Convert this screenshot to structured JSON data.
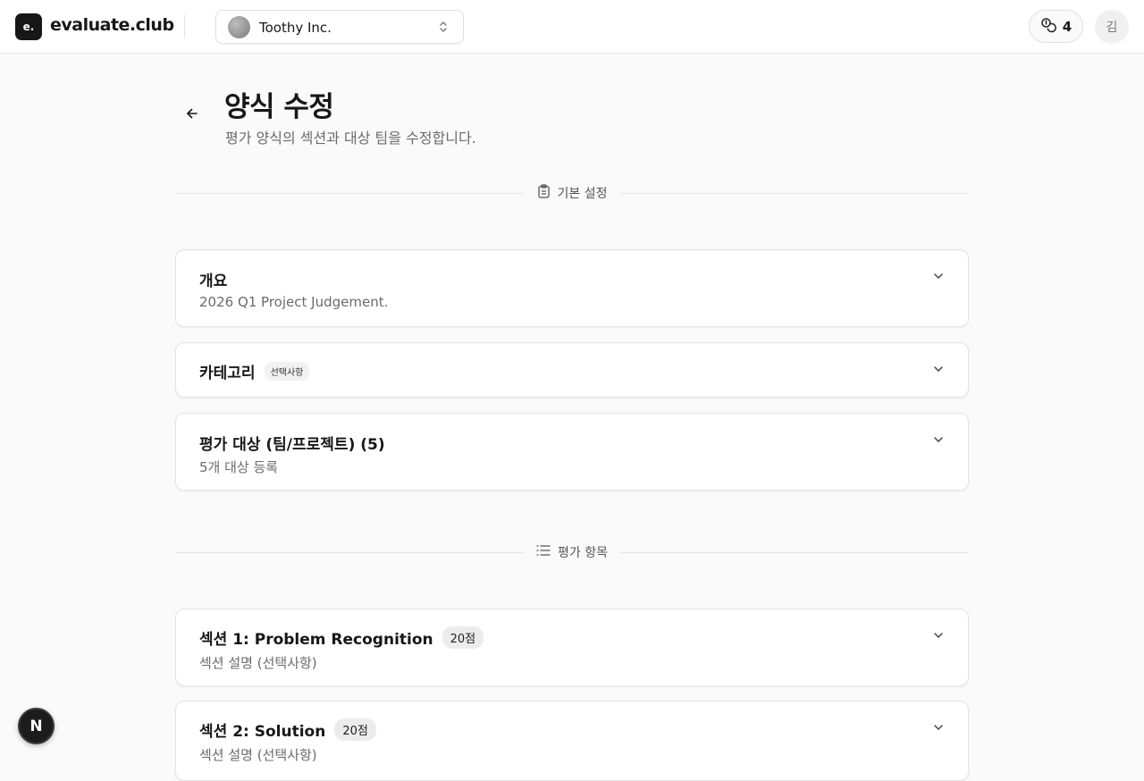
{
  "header": {
    "logo_mark": "e.",
    "logo_text": "evaluate.club",
    "org_name": "Toothy Inc.",
    "credits": "4",
    "user_initial": "김"
  },
  "page": {
    "title": "양식 수정",
    "subtitle": "평가 양식의 섹션과 대상 팀을 수정합니다."
  },
  "basic_section": {
    "label": "기본 설정",
    "cards": {
      "overview": {
        "title": "개요",
        "desc": "2026 Q1 Project Judgement."
      },
      "category": {
        "title": "카테고리",
        "badge": "선택사항"
      },
      "targets": {
        "title": "평가 대상 (팀/프로젝트) (5)",
        "desc": "5개 대상 등록"
      }
    }
  },
  "items_section": {
    "label": "평가 항목",
    "sections": [
      {
        "title": "섹션 1: Problem Recognition",
        "points": "20점",
        "desc": "섹션 설명 (선택사항)"
      },
      {
        "title": "섹션 2: Solution",
        "points": "20점",
        "desc": "섹션 설명 (선택사항)"
      }
    ]
  },
  "dev_badge": "N",
  "colors": {
    "brand": "#171717",
    "background": "#fafafa",
    "border": "#e3e3e3",
    "muted_text": "#6b6b6b"
  }
}
